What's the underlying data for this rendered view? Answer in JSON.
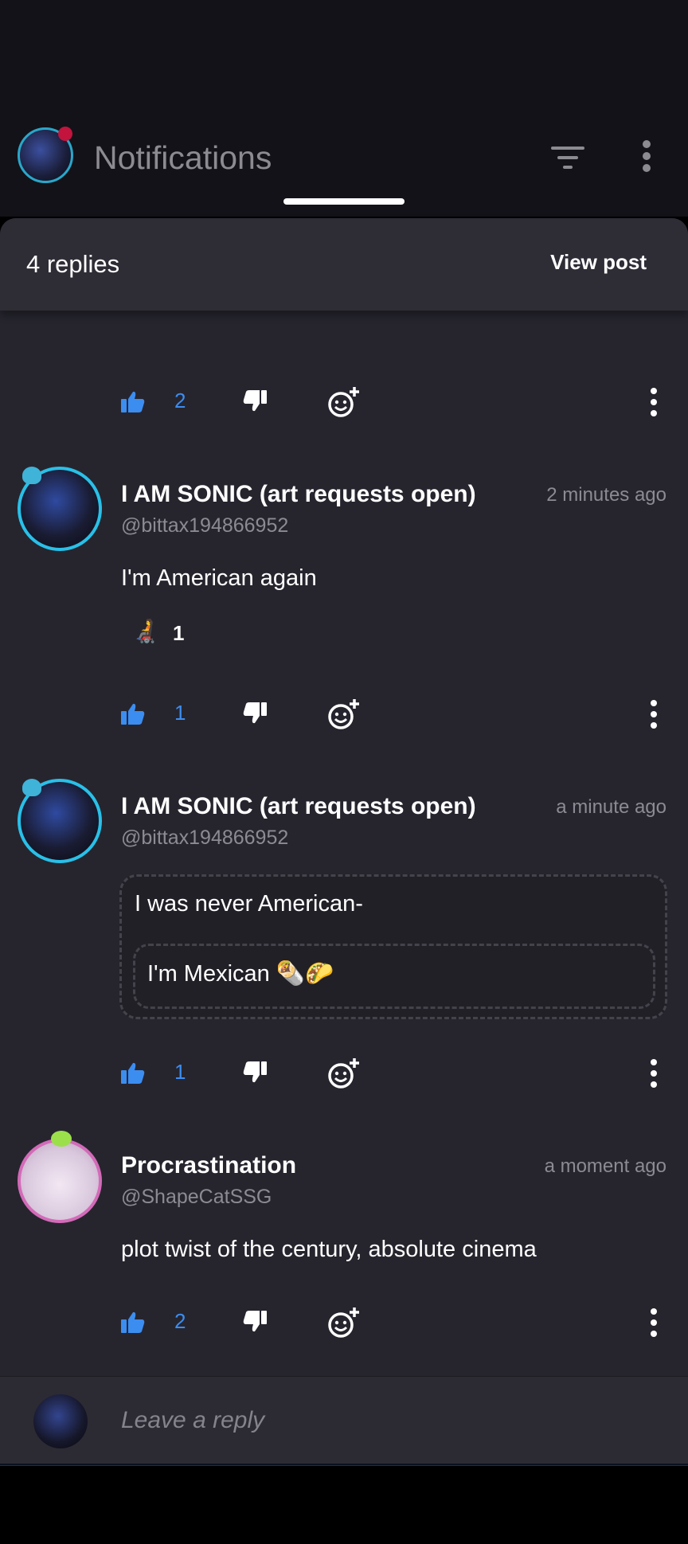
{
  "header": {
    "title": "Notifications",
    "filter_icon": "filter-icon",
    "menu_icon": "kebab-menu-icon"
  },
  "sheet": {
    "replies_count": "4 replies",
    "view_post_label": "View post"
  },
  "actions": [
    {
      "likes": "2"
    },
    {
      "likes": "1"
    },
    {
      "likes": "1"
    },
    {
      "likes": "2"
    }
  ],
  "replies": [
    {
      "name": "I AM SONIC (art requests open)",
      "handle": "@bittax194866952",
      "time": "2 minutes ago",
      "text": "I'm American again",
      "reaction": {
        "emoji": "🧑‍🦼",
        "count": "1"
      }
    },
    {
      "name": "I AM SONIC (art requests open)",
      "handle": "@bittax194866952",
      "time": "a minute ago",
      "quote_line_1": "I was never American-",
      "quote_line_2": "I'm Mexican 🌯🌮"
    },
    {
      "name": "Procrastination",
      "handle": "@ShapeCatSSG",
      "time": "a moment ago",
      "text": "plot twist of the century, absolute cinema"
    }
  ],
  "reply_box": {
    "placeholder": "Leave a reply"
  },
  "colors": {
    "accent": "#3c8df0",
    "background": "#26252e",
    "topbar": "#131218"
  }
}
